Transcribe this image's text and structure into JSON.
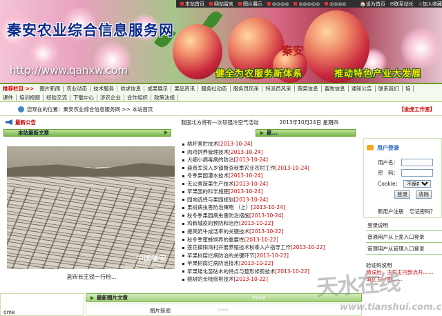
{
  "topbar": {
    "items": [
      "本站首页",
      "网站留言",
      "图片展示",
      "◎◎◎◎",
      "◎◎◎◎◎",
      "◎◎◎◎"
    ],
    "right": [
      "设为首页",
      "联系站长",
      "加入收藏"
    ]
  },
  "banner": {
    "site_title": "秦安农业综合信息服务网",
    "url": "http://www.qanxw.com",
    "slogan_left": "健全为农服务新体系",
    "slogan_right": "推动特色产业大发展",
    "stamp": "秦安"
  },
  "nav": {
    "row1": [
      "推荐栏目 >>",
      "图片新闻",
      "农业动态",
      "技术服务",
      "供求信息",
      "成果展示",
      "果品资讯",
      "服务社动态",
      "服务员风采",
      "特派员风采",
      "蔬菜信息",
      "畜牧信息",
      "通知公告",
      "联系我们",
      "培"
    ],
    "row2": [
      "课件",
      "培训视频",
      "经验交流",
      "下载中心",
      "涉农企业",
      "合作组织",
      "政策法规"
    ]
  },
  "info": {
    "location_label": "您现在的位置：",
    "location_path": "秦安农业综合信息服务网 >> 本站首页",
    "work_room": "【金虎工作室】"
  },
  "newsbar": {
    "label": "最新公告",
    "text": "我国北方将有一次较强冷空气活动",
    "date": "2013年10月24日 星期四"
  },
  "latest": {
    "heading": "本站最新文章",
    "side_heading": "最...",
    "photo_caption": "副市长王锐一行检...",
    "photo_watermark": "中国秦安",
    "photo_watermark_url": "www.qinan.gov.cn",
    "items": [
      {
        "title": "桃杆害贮技术",
        "date": "[2013-10-24]"
      },
      {
        "title": "肉鸡饲养管理技术",
        "date": "[2013-10-24]"
      },
      {
        "title": "犬细小病毒病的防治",
        "date": "[2013-10-24]"
      },
      {
        "title": "裴贵军深入乡镇督查秋季农业农村工作",
        "date": "[2013-10-24]"
      },
      {
        "title": "冬季果园灌水技术",
        "date": "[2013-10-24]"
      },
      {
        "title": "无公害蔬菜生产技术",
        "date": "[2013-10-24]"
      },
      {
        "title": "苹果园的科学施肥",
        "date": "[2013-10-24]"
      },
      {
        "title": "园地选择与果园规划",
        "date": "[2013-10-24]"
      },
      {
        "title": "果树病虫害防治策略 （上）",
        "date": "[2013-10-24]"
      },
      {
        "title": "秋冬季果园病虫害防治措施",
        "date": "[2013-10-24]"
      },
      {
        "title": "鸡新城疫的预防和治疗",
        "date": "[2013-10-22]"
      },
      {
        "title": "提高奶牛成活率的关键技术",
        "date": "[2013-10-22]"
      },
      {
        "title": "秋冬季蜜蜂饲养的重要性",
        "date": "[2013-10-22]"
      },
      {
        "title": "莲花镇阳湾村开展养殖技术秋季入户指导工作",
        "date": "[2013-10-22]"
      },
      {
        "title": "苹果树腐烂病防治的关键环节",
        "date": "[2013-10-22]"
      },
      {
        "title": "苹果树腐烂病防治技术",
        "date": "[2013-10-22]"
      },
      {
        "title": "苹果矮化苗砧木的特点与整形修剪技术",
        "date": "[2013-10-22]"
      },
      {
        "title": "桃树的长枝修剪技术",
        "date": "[2013-10-22]"
      }
    ]
  },
  "login": {
    "heading": "用户登录",
    "username_label": "用户名：",
    "password_label": "密　码：",
    "cookie_label": "Cookie：",
    "cookie_value": "不保存",
    "login_button": "登录",
    "clear_button": "清除",
    "register_link": "新用户注册",
    "forgot_link": "忘记密码？"
  },
  "right_links": [
    "登录说明",
    "普通用户从上面入口登录",
    "管理用户从管理入口登录",
    "验证码说明"
  ],
  "bottom_right": [
    "验证码说明",
    "错误后，主页主内部点开……",
    "请立主一图……"
  ],
  "bottom": {
    "left_box_sub": "ome",
    "section_heading": "最新图片文章",
    "more": "more",
    "tab_label": "图片新闻",
    "tab_sub": "more"
  },
  "watermark": {
    "text": "天水在线",
    "url": "www.tianshui.com.cn"
  }
}
